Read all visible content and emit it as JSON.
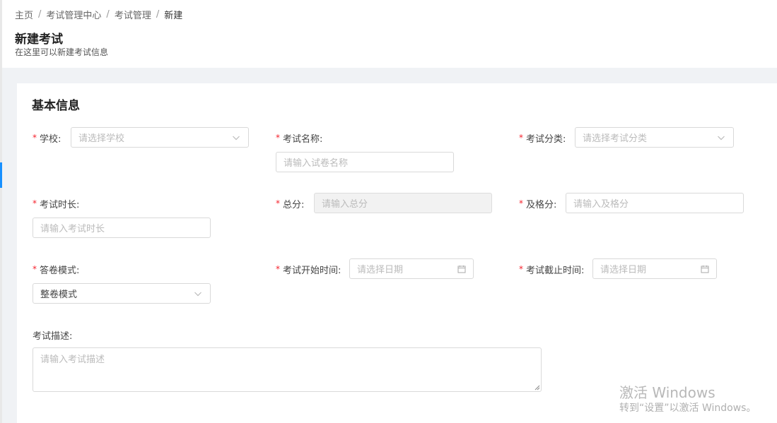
{
  "breadcrumb": {
    "items": [
      "主页",
      "考试管理中心",
      "考试管理",
      "新建"
    ],
    "separator": "/"
  },
  "page": {
    "title": "新建考试",
    "subtitle": "在这里可以新建考试信息"
  },
  "section": {
    "title": "基本信息"
  },
  "form": {
    "school": {
      "label": "学校:",
      "placeholder": "请选择学校"
    },
    "exam_name": {
      "label": "考试名称:",
      "placeholder": "请输入试卷名称"
    },
    "exam_category": {
      "label": "考试分类:",
      "placeholder": "请选择考试分类"
    },
    "duration": {
      "label": "考试时长:",
      "placeholder": "请输入考试时长"
    },
    "total_score": {
      "label": "总分:",
      "placeholder": "请输入总分"
    },
    "pass_score": {
      "label": "及格分:",
      "placeholder": "请输入及格分"
    },
    "answer_mode": {
      "label": "答卷模式:",
      "value": "整卷模式"
    },
    "start_time": {
      "label": "考试开始时间:",
      "placeholder": "请选择日期"
    },
    "end_time": {
      "label": "考试截止时间:",
      "placeholder": "请选择日期"
    },
    "description": {
      "label": "考试描述:",
      "placeholder": "请输入考试描述"
    },
    "required_mark": "*"
  },
  "watermark": {
    "title": "激活 Windows",
    "subtitle": "转到“设置”以激活 Windows。"
  },
  "colors": {
    "required": "#f5222d",
    "accent": "#1890ff",
    "background": "#f0f2f5"
  },
  "icons": [
    "chevron-down-icon",
    "calendar-icon",
    "resize-handle-icon"
  ]
}
